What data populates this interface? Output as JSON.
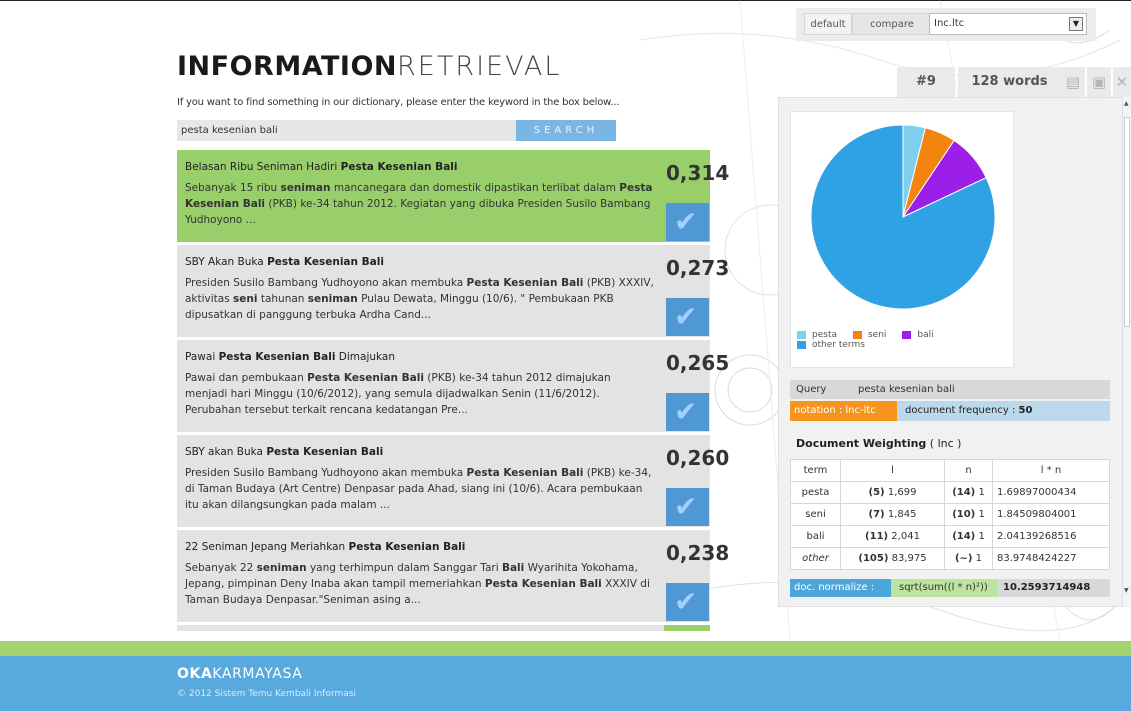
{
  "brand": {
    "bold": "INFORMATION",
    "light": "RETRIEVAL"
  },
  "intro": "If you want to find something in our dictionary, please enter the keyword in the box below...",
  "search": {
    "value": "pesta kesenian bali",
    "button": "SEARCH"
  },
  "results": [
    {
      "title_parts": [
        [
          "Belasan Ribu Seniman Hadiri ",
          false
        ],
        [
          "Pesta Kesenian Bali",
          true
        ]
      ],
      "snippet_parts": [
        [
          "Sebanyak 15 ribu ",
          false
        ],
        [
          "seniman",
          true
        ],
        [
          " mancanegara dan domestik dipastikan terlibat dalam ",
          false
        ],
        [
          "",
          false
        ],
        [
          "Pesta Kesenian Bali",
          true
        ],
        [
          " (PKB) ke-34 tahun 2012. Kegiatan yang   dibuka Presiden Susilo Bambang Yudhoyono ...",
          false
        ]
      ],
      "score": "0,314",
      "active": true
    },
    {
      "title_parts": [
        [
          "SBY Akan Buka ",
          false
        ],
        [
          "Pesta Kesenian Bali",
          true
        ]
      ],
      "snippet_parts": [
        [
          "Presiden Susilo Bambang Yudhoyono akan membuka ",
          false
        ],
        [
          "Pesta Kesenian Bali",
          true
        ],
        [
          " (PKB) XXXIV, aktivitas ",
          false
        ],
        [
          "seni",
          true
        ],
        [
          " tahunan ",
          false
        ],
        [
          "seniman",
          true
        ],
        [
          " Pulau Dewata, Minggu (10/6). \" Pembukaan PKB dipusatkan di panggung terbuka Ardha Cand...",
          false
        ]
      ],
      "score": "0,273",
      "active": false
    },
    {
      "title_parts": [
        [
          "Pawai ",
          false
        ],
        [
          "Pesta Kesenian Bali",
          true
        ],
        [
          " Dimajukan",
          false
        ]
      ],
      "snippet_parts": [
        [
          "Pawai dan pembukaan ",
          false
        ],
        [
          "Pesta Kesenian Bali",
          true
        ],
        [
          " (PKB) ke-34 tahun 2012 dimajukan menjadi hari Minggu (10/6/2012), yang semula dijadwalkan Senin (11/6/2012). Perubahan tersebut terkait rencana kedatangan Pre...",
          false
        ]
      ],
      "score": "0,265",
      "active": false
    },
    {
      "title_parts": [
        [
          "SBY akan Buka ",
          false
        ],
        [
          "Pesta Kesenian Bali",
          true
        ]
      ],
      "snippet_parts": [
        [
          "Presiden Susilo Bambang Yudhoyono akan membuka ",
          false
        ],
        [
          "Pesta Kesenian Bali",
          true
        ],
        [
          " (PKB) ke-34, di Taman Budaya (Art Centre) Denpasar pada Ahad, siang ini (10/6). Acara pembukaan itu akan dilangsungkan pada malam ...",
          false
        ]
      ],
      "score": "0,260",
      "active": false
    },
    {
      "title_parts": [
        [
          "22 Seniman Jepang Meriahkan ",
          false
        ],
        [
          "Pesta Kesenian Bali",
          true
        ]
      ],
      "snippet_parts": [
        [
          "Sebanyak 22 ",
          false
        ],
        [
          "seniman",
          true
        ],
        [
          " yang terhimpun dalam Sanggar Tari ",
          false
        ],
        [
          "Bali",
          true
        ],
        [
          " Wyarihita Yokohama, Jepang, pimpinan Deny Inaba akan tampil memeriahkan ",
          false
        ],
        [
          "Pesta Kesenian Bali",
          true
        ],
        [
          " XXXIV di Taman Budaya Denpasar.\"Seniman asing a...",
          false
        ]
      ],
      "score": "0,238",
      "active": false
    }
  ],
  "mode": {
    "default": "default",
    "compare": "compare",
    "select_value": "Inc.ltc"
  },
  "toolbar": {
    "doc_num": "#9",
    "word_count": "128 words"
  },
  "chart_data": {
    "type": "pie",
    "categories": [
      "pesta",
      "seni",
      "bali",
      "other terms"
    ],
    "values": [
      5,
      7,
      11,
      105
    ],
    "colors": [
      "#81cfee",
      "#f2840f",
      "#9b1fe8",
      "#2fa2e6"
    ],
    "legend_position": "bottom"
  },
  "query": {
    "label": "Query",
    "value": "pesta kesenian bali"
  },
  "notation": "notation : lnc-ltc",
  "docfreq": {
    "label": "document frequency : ",
    "value": "50"
  },
  "weighting": {
    "title": "Document Weighting",
    "sub": "( lnc )",
    "headers": [
      "term",
      "l",
      "n",
      "l * n"
    ],
    "rows": [
      {
        "term": "pesta",
        "l_count": "(5)",
        "l_val": "1,699",
        "n_count": "(14)",
        "n_val": "1",
        "ln": "1.69897000434",
        "italic": false
      },
      {
        "term": "seni",
        "l_count": "(7)",
        "l_val": "1,845",
        "n_count": "(10)",
        "n_val": "1",
        "ln": "1.84509804001",
        "italic": false
      },
      {
        "term": "bali",
        "l_count": "(11)",
        "l_val": "2,041",
        "n_count": "(14)",
        "n_val": "1",
        "ln": "2.04139268516",
        "italic": false
      },
      {
        "term": "other",
        "l_count": "(105)",
        "l_val": "83,975",
        "n_count": "(~)",
        "n_val": "1",
        "ln": "83.9748424227",
        "italic": true
      }
    ]
  },
  "normalize": {
    "label": "doc. normalize :",
    "formula": "sqrt(sum((l * n)²))",
    "value": "10.2593714948"
  },
  "footer": {
    "bold": "OKA",
    "light": "KARMAYASA",
    "copyright": "© 2012 Sistem Temu Kembali Informasi"
  }
}
